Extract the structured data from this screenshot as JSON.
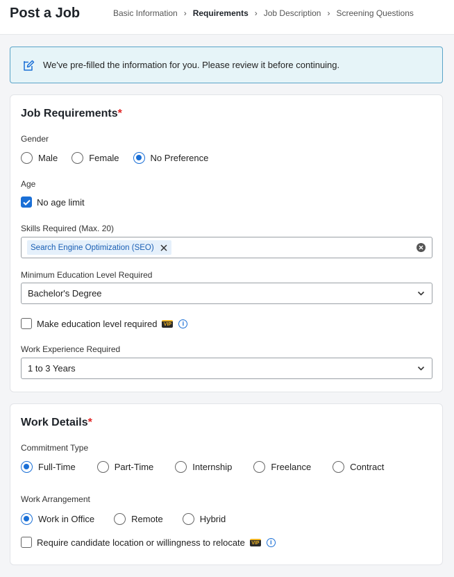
{
  "header": {
    "title": "Post a Job",
    "steps": [
      "Basic Information",
      "Requirements",
      "Job Description",
      "Screening Questions"
    ],
    "separator": "›"
  },
  "banner": {
    "text": "We've pre-filled the information for you. Please review it before continuing.",
    "icon": "edit-note-icon"
  },
  "requirements": {
    "title": "Job Requirements",
    "required_mark": "*",
    "gender": {
      "label": "Gender",
      "options": [
        "Male",
        "Female",
        "No Preference"
      ],
      "selected": "No Preference"
    },
    "age": {
      "label": "Age",
      "no_limit_label": "No age limit",
      "no_limit_checked": true
    },
    "skills": {
      "label": "Skills Required (Max. 20)",
      "tags": [
        "Search Engine Optimization (SEO)"
      ]
    },
    "education": {
      "label": "Minimum Education Level Required",
      "value": "Bachelor's Degree",
      "required_check_label": "Make education level required",
      "required_checked": false,
      "badge": "VIP"
    },
    "experience": {
      "label": "Work Experience Required",
      "value": "1 to 3 Years"
    }
  },
  "work_details": {
    "title": "Work Details",
    "required_mark": "*",
    "commitment": {
      "label": "Commitment Type",
      "options": [
        "Full-Time",
        "Part-Time",
        "Internship",
        "Freelance",
        "Contract"
      ],
      "selected": "Full-Time"
    },
    "arrangement": {
      "label": "Work Arrangement",
      "options": [
        "Work in Office",
        "Remote",
        "Hybrid"
      ],
      "selected": "Work in Office"
    },
    "relocate": {
      "label": "Require candidate location or willingness to relocate",
      "checked": false,
      "badge": "VIP"
    }
  },
  "colors": {
    "accent": "#1a6fd6",
    "required": "#e02424",
    "banner_bg": "#e6f4f8",
    "banner_border": "#5aa4c8"
  }
}
